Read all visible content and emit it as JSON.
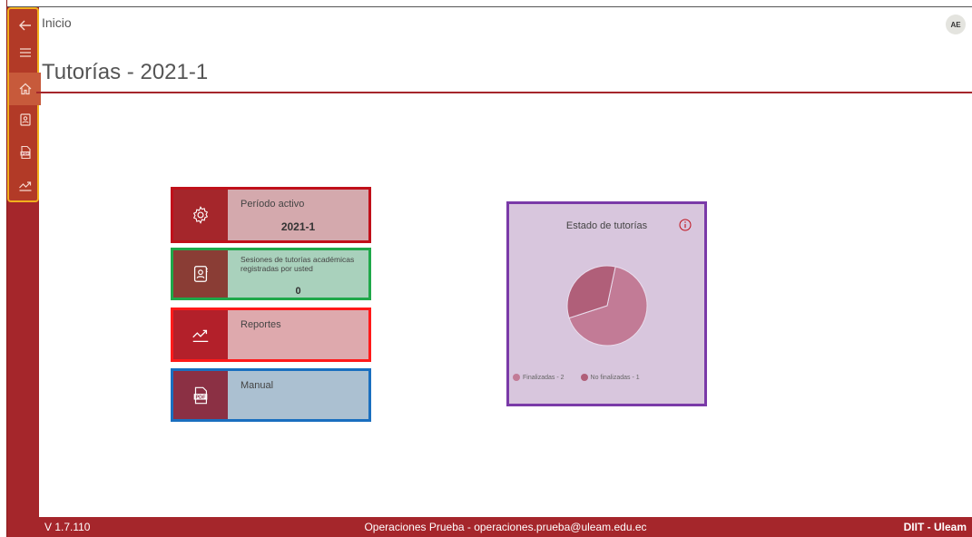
{
  "header": {
    "breadcrumb": "Inicio",
    "avatar_initials": "AE",
    "page_title": "Tutorías - 2021-1"
  },
  "sidebar": {
    "items": [
      {
        "icon": "back-arrow-icon"
      },
      {
        "icon": "menu-icon"
      },
      {
        "icon": "home-icon",
        "active": true
      },
      {
        "icon": "contact-book-icon"
      },
      {
        "icon": "pdf-icon"
      },
      {
        "icon": "trend-chart-icon"
      }
    ]
  },
  "cards": {
    "periodo": {
      "label": "Período activo",
      "value": "2021-1",
      "icon": "gear-icon"
    },
    "sesiones": {
      "label": "Sesiones de tutorías académicas registradas por usted",
      "value": "0",
      "icon": "contact-book-icon"
    },
    "reportes": {
      "label": "Reportes",
      "icon": "trend-chart-icon"
    },
    "manual": {
      "label": "Manual",
      "icon": "pdf-icon"
    }
  },
  "chart_data": {
    "type": "pie",
    "title": "Estado de tutorías",
    "categories": [
      "Finalizadas - 2",
      "No finalizadas - 1"
    ],
    "values": [
      2,
      1
    ],
    "colors": [
      "#c27b96",
      "#b05f79"
    ],
    "legend": "bottom-left"
  },
  "footer": {
    "version": "V 1.7.110",
    "user": "Operaciones Prueba - operaciones.prueba@uleam.edu.ec",
    "brand": "DIIT - Uleam"
  },
  "colors": {
    "brand": "#a5262b",
    "sidebar_highlight": "#f2b01e"
  }
}
